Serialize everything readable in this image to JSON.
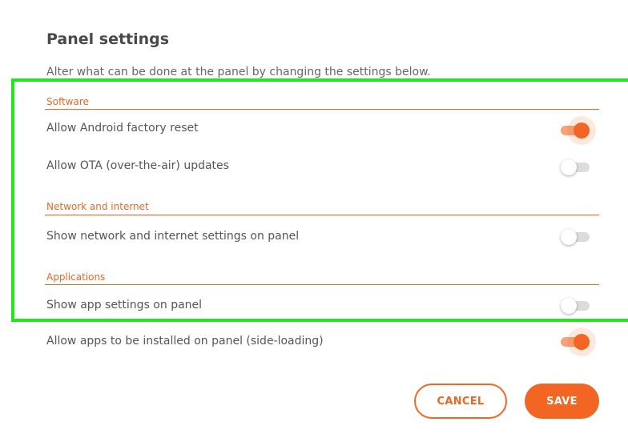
{
  "header": {
    "title": "Panel settings",
    "subtitle": "Alter what can be done at the panel by changing the settings below."
  },
  "sections": [
    {
      "title": "Software",
      "rows": [
        {
          "label": "Allow Android factory reset",
          "enabled": true
        },
        {
          "label": "Allow OTA (over-the-air) updates",
          "enabled": false
        }
      ]
    },
    {
      "title": "Network and internet",
      "rows": [
        {
          "label": "Show network and internet settings on panel",
          "enabled": false
        }
      ]
    },
    {
      "title": "Applications",
      "rows": [
        {
          "label": "Show app settings on panel",
          "enabled": false
        },
        {
          "label": "Allow apps to be installed on panel (side-loading)",
          "enabled": true
        }
      ]
    }
  ],
  "actions": {
    "cancel_label": "CANCEL",
    "save_label": "SAVE"
  },
  "colors": {
    "accent": "#f26522",
    "highlight": "#22e61e"
  }
}
